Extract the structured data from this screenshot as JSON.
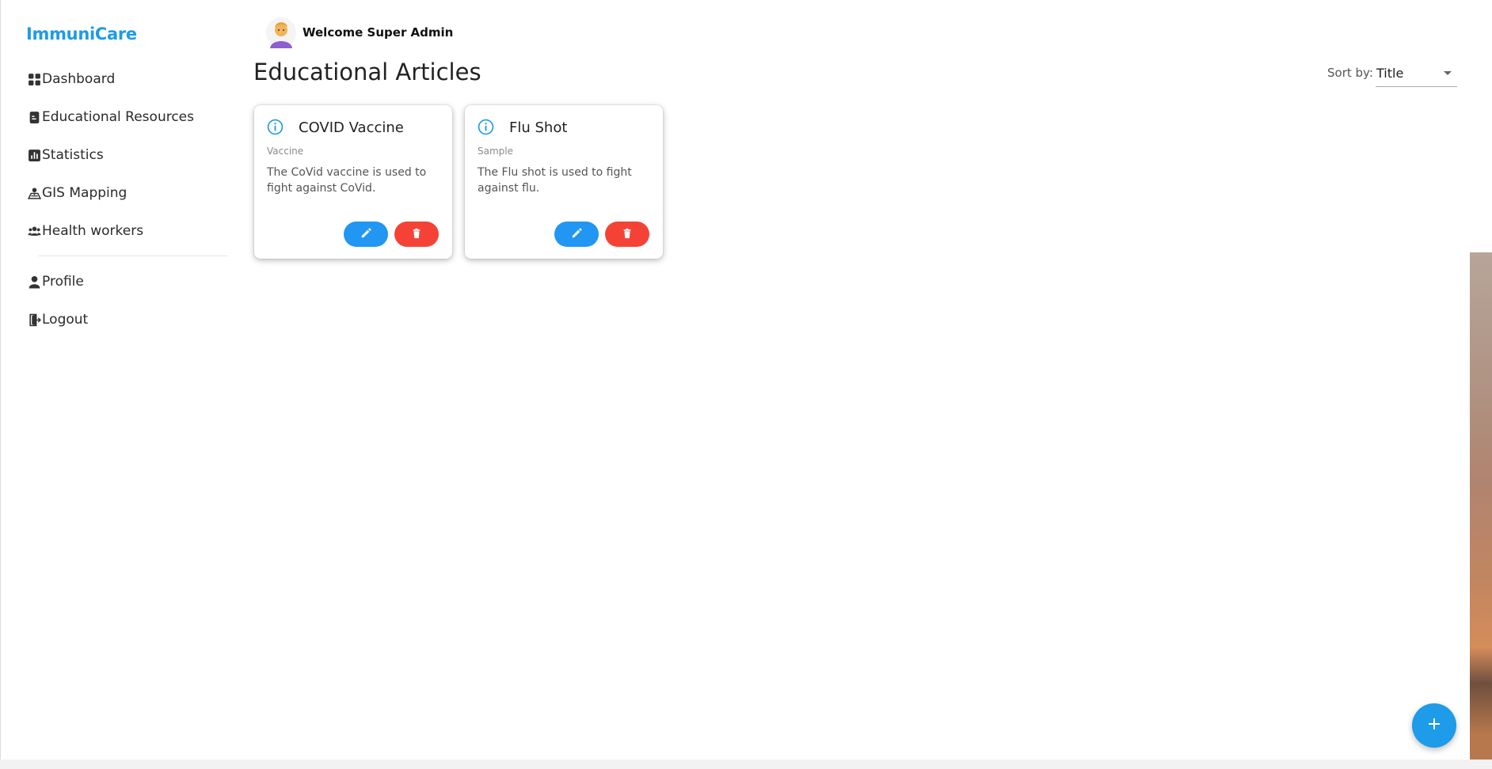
{
  "app": {
    "brand": "ImmuniCare"
  },
  "sidebar": {
    "items": [
      {
        "label": "Dashboard",
        "icon": "dashboard-icon"
      },
      {
        "label": "Educational Resources",
        "icon": "document-icon"
      },
      {
        "label": "Statistics",
        "icon": "chart-icon"
      },
      {
        "label": "GIS Mapping",
        "icon": "map-icon"
      },
      {
        "label": "Health workers",
        "icon": "people-icon"
      }
    ],
    "footer_items": [
      {
        "label": "Profile",
        "icon": "user-icon"
      },
      {
        "label": "Logout",
        "icon": "logout-icon"
      }
    ]
  },
  "header": {
    "welcome": "Welcome Super Admin",
    "page_title": "Educational Articles"
  },
  "sort": {
    "label": "Sort by:",
    "value": "Title"
  },
  "articles": [
    {
      "title": "COVID Vaccine",
      "category": "Vaccine",
      "description": "The CoVid vaccine is used to fight against CoVid."
    },
    {
      "title": "Flu Shot",
      "category": "Sample",
      "description": "The Flu shot is used to fight against flu."
    }
  ],
  "colors": {
    "accent": "#1e9be9",
    "edit": "#2196f3",
    "delete": "#f44336"
  },
  "icons": {
    "card_info": "info-icon",
    "card_edit": "pencil-icon",
    "card_delete": "trash-icon",
    "fab": "plus-icon"
  }
}
